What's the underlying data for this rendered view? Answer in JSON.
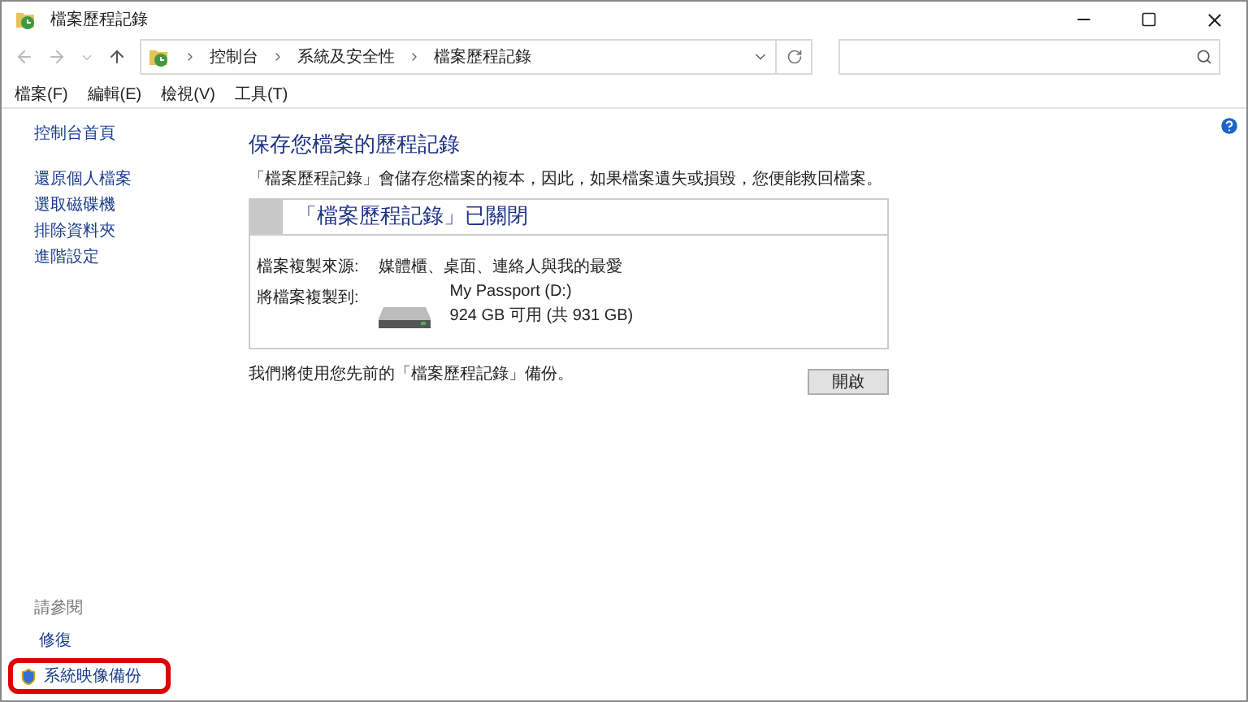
{
  "window": {
    "title": "檔案歷程記錄"
  },
  "breadcrumb": [
    "控制台",
    "系統及安全性",
    "檔案歷程記錄"
  ],
  "menu": [
    "檔案(F)",
    "編輯(E)",
    "檢視(V)",
    "工具(T)"
  ],
  "sidebar": {
    "links": [
      {
        "label": "控制台首頁"
      },
      {
        "label": "還原個人檔案"
      },
      {
        "label": "選取磁碟機"
      },
      {
        "label": "排除資料夾"
      },
      {
        "label": "進階設定"
      }
    ],
    "see_also": {
      "title": "請參閱",
      "items": [
        {
          "label": "修復",
          "kind": "plain",
          "highlighted": false
        },
        {
          "label": "系統映像備份",
          "kind": "shield",
          "highlighted": true
        }
      ]
    }
  },
  "main": {
    "heading": "保存您檔案的歷程記錄",
    "description": "「檔案歷程記錄」會儲存您檔案的複本，因此，如果檔案遺失或損毀，您便能救回檔案。",
    "status": {
      "title": "「檔案歷程記錄」已關閉",
      "source_label": "檔案複製來源:",
      "source_value": "媒體櫃、桌面、連絡人與我的最愛",
      "target_label": "將檔案複製到:",
      "drive_name": "My Passport (D:)",
      "drive_space": "924 GB 可用 (共 931 GB)"
    },
    "note": "我們將使用您先前的「檔案歷程記錄」備份。",
    "button": "開啟"
  }
}
